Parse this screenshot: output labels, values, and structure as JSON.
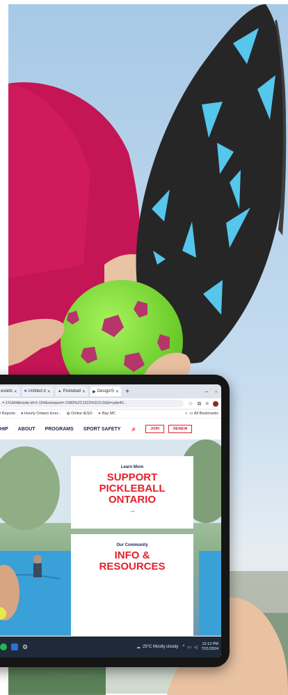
{
  "browser": {
    "tabs": [
      {
        "label": "wsletti",
        "active": false
      },
      {
        "label": "Untitled d",
        "active": false
      },
      {
        "label": "Pickleball",
        "active": false
      },
      {
        "label": "Design/S",
        "active": true
      }
    ],
    "url": "=-1%3A4&node-id=1-154&viewport=-1080%2C1522%2C0.56&t=ydw40...",
    "bookmarks": [
      "l Reports",
      "Hourly Ontario Ener...",
      "Online IESO",
      "Bay MC"
    ],
    "bookmarks_all": "All Bookmarks"
  },
  "site": {
    "nav": [
      "HIP",
      "ABOUT",
      "PROGRAMS",
      "SPORT SAFETY"
    ],
    "join_label": "JOIN",
    "renew_label": "RENEW",
    "card1": {
      "eyebrow": "Learn More",
      "title_lines": [
        "SUPPORT",
        "PICKLEBALL",
        "ONTARIO"
      ],
      "arrow": "→"
    },
    "card2": {
      "eyebrow": "Our Community",
      "title_lines": [
        "INFO &",
        "RESOURCES"
      ]
    }
  },
  "taskbar": {
    "weather": "25°C  Mostly cloudy",
    "time": "12:12 PM",
    "date": "7/21/2024"
  },
  "colors": {
    "shirt": "#c41554",
    "paddle": "#262626",
    "paddle_accent": "#55c6ec",
    "ball": "#7fe338",
    "ball_holes": "#b6366b",
    "sky_top": "#a7c9e6",
    "brand_red": "#e3202d",
    "brand_navy": "#1b2550"
  }
}
